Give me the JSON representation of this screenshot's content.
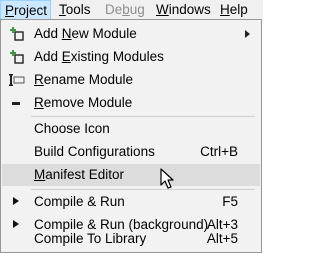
{
  "menubar": {
    "items": [
      {
        "label": "Project",
        "mnemonic": "P",
        "state": "active"
      },
      {
        "label": "Tools",
        "mnemonic": "T",
        "state": "normal"
      },
      {
        "label": "Debug",
        "mnemonic": "b",
        "state": "disabled"
      },
      {
        "label": "Windows",
        "mnemonic": "W",
        "state": "normal"
      },
      {
        "label": "Help",
        "mnemonic": "H",
        "state": "normal"
      }
    ]
  },
  "menu": {
    "items": [
      {
        "label": "Add New Module",
        "mnemonic": "N",
        "icon": "add-new-module-icon",
        "submenu": true
      },
      {
        "label": "Add Existing Modules",
        "mnemonic": "E",
        "icon": "add-existing-modules-icon"
      },
      {
        "label": "Rename Module",
        "mnemonic": "R",
        "icon": "rename-module-icon"
      },
      {
        "label": "Remove Module",
        "mnemonic": "R",
        "icon": "remove-module-icon"
      },
      {
        "label": "Choose Icon"
      },
      {
        "label": "Build Configurations",
        "shortcut": "Ctrl+B"
      },
      {
        "label": "Manifest Editor",
        "mnemonic": "M",
        "highlighted": true
      },
      {
        "label": "Compile & Run",
        "shortcut": "F5",
        "icon": "play-icon"
      },
      {
        "label": "Compile & Run (background)",
        "shortcut": "Alt+3",
        "icon": "play-icon"
      },
      {
        "label": "Compile To Library",
        "shortcut": "Alt+5"
      }
    ]
  },
  "colors": {
    "menubar_bg": "#f0f0f0",
    "menu_bg": "#f2f2f2",
    "active_menu_bg": "#cce8ff",
    "highlight_bg": "#dcdcdc",
    "icon_green": "#3c9a3c"
  }
}
